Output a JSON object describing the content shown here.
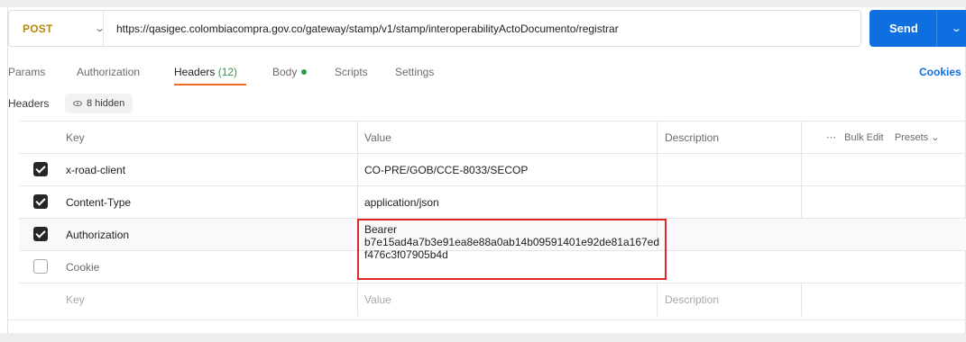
{
  "request": {
    "method": "POST",
    "url": "https://qasigec.colombiacompra.gov.co/gateway/stamp/v1/stamp/interoperabilityActoDocumento/registrar",
    "send_label": "Send"
  },
  "tabs": [
    {
      "label": "Params"
    },
    {
      "label": "Authorization"
    },
    {
      "label": "Headers",
      "count": "(12)"
    },
    {
      "label": "Body"
    },
    {
      "label": "Scripts"
    },
    {
      "label": "Settings"
    }
  ],
  "cookies_label": "Cookies",
  "headers_section": {
    "label": "Headers",
    "hidden_label": "8 hidden"
  },
  "table": {
    "columns": {
      "key": "Key",
      "value": "Value",
      "description": "Description"
    },
    "bulk_edit": "Bulk Edit",
    "presets": "Presets",
    "rows": [
      {
        "key": "x-road-client",
        "value": "CO-PRE/GOB/CCE-8033/SECOP",
        "checked": true
      },
      {
        "key": "Content-Type",
        "value": "application/json",
        "checked": true
      },
      {
        "key": "Authorization",
        "value": "Bearer\nb7e15ad4a7b3e91ea8e88a0ab14b09591401e92de81a167edf476c3f07905b4d",
        "checked": true
      },
      {
        "key": "Cookie",
        "value": "",
        "checked": false
      }
    ],
    "placeholder": {
      "key": "Key",
      "value": "Value",
      "description": "Description"
    }
  },
  "colors": {
    "method": "#b7870b",
    "send": "#0f6ee0",
    "active_tab_underline": "#f06a2a",
    "highlight_box": "#e0262d"
  }
}
